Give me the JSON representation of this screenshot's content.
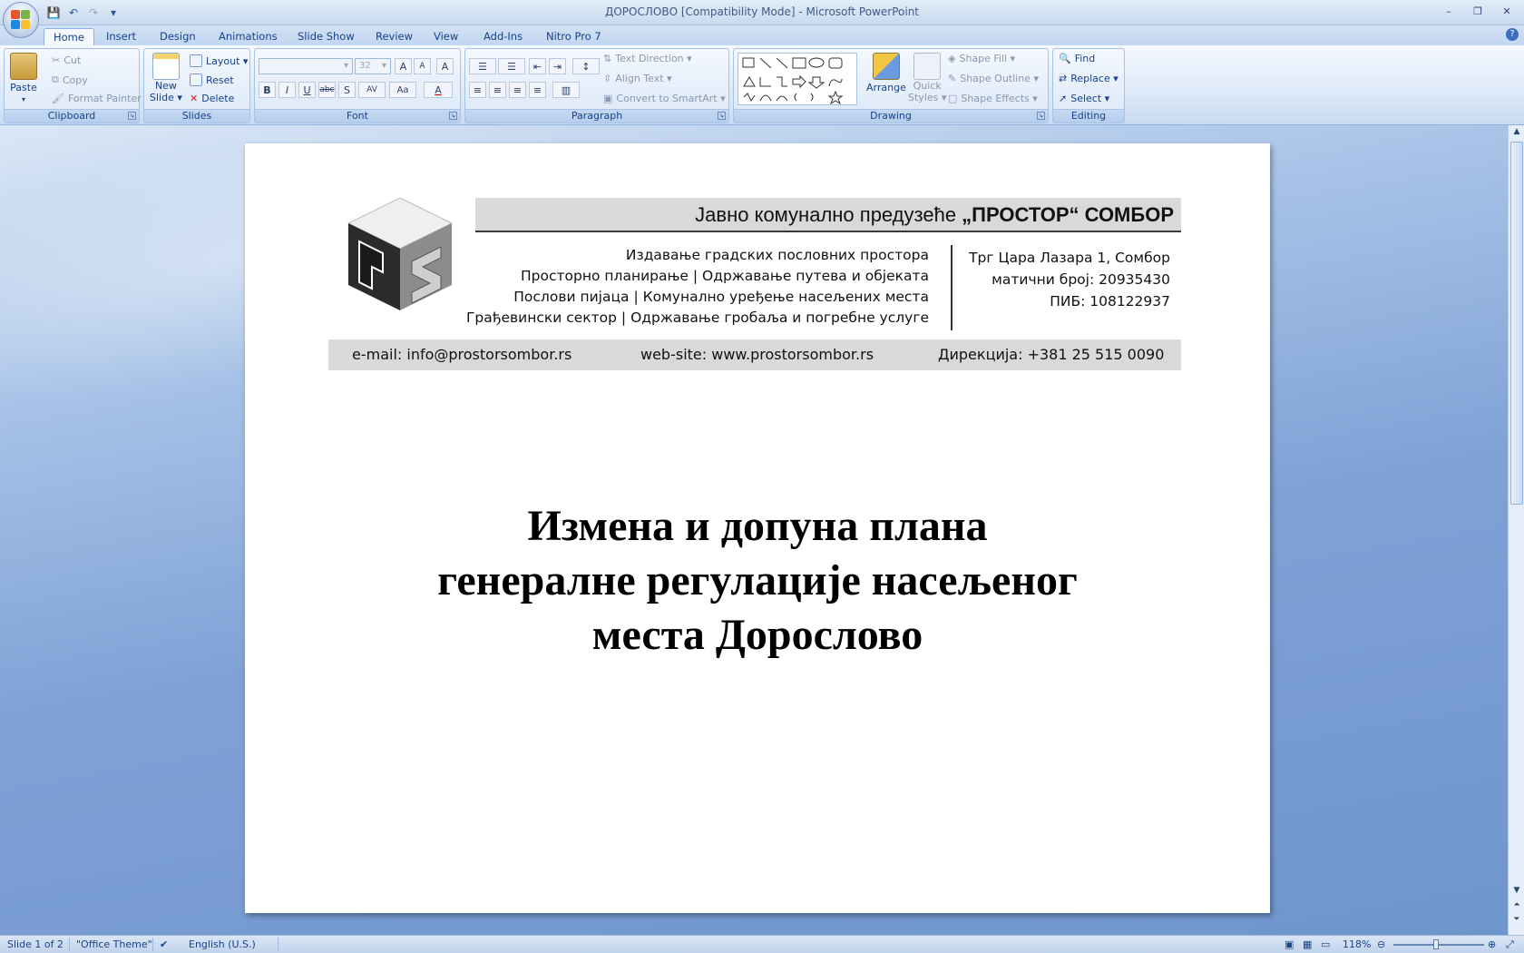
{
  "window": {
    "title": "ДОРОСЛОВО [Compatibility Mode] - Microsoft PowerPoint",
    "minimize": "–",
    "restore": "❐",
    "close": "✕"
  },
  "quick_access": {
    "save": "💾",
    "undo": "↶",
    "redo": "↷",
    "customize": "▾"
  },
  "tabs": [
    "Home",
    "Insert",
    "Design",
    "Animations",
    "Slide Show",
    "Review",
    "View",
    "Add-Ins",
    "Nitro Pro 7"
  ],
  "help": "?",
  "ribbon": {
    "clipboard": {
      "label": "Clipboard",
      "paste": "Paste",
      "cut": "Cut",
      "copy": "Copy",
      "format_painter": "Format Painter"
    },
    "slides": {
      "label": "Slides",
      "new_slide": "New",
      "new_slide_2": "Slide ▾",
      "layout": "Layout ▾",
      "reset": "Reset",
      "delete": "Delete"
    },
    "font": {
      "label": "Font",
      "font_name": "",
      "font_size": "32",
      "grow": "A",
      "shrink": "A",
      "clear": "A",
      "bold": "B",
      "italic": "I",
      "underline": "U",
      "strike": "abc",
      "shadow": "S",
      "spacing": "AV",
      "case": "Aa",
      "color": "A"
    },
    "paragraph": {
      "label": "Paragraph",
      "text_direction": "Text Direction ▾",
      "align_text": "Align Text ▾",
      "convert_smartart": "Convert to SmartArt ▾"
    },
    "drawing": {
      "label": "Drawing",
      "arrange": "Arrange",
      "quick": "Quick",
      "styles": "Styles ▾",
      "shape_fill": "Shape Fill ▾",
      "shape_outline": "Shape Outline ▾",
      "shape_effects": "Shape Effects ▾"
    },
    "editing": {
      "label": "Editing",
      "find": "Find",
      "replace": "Replace ▾",
      "select": "Select ▾"
    }
  },
  "slide": {
    "company_prefix": "Јавно комунално предузеће ",
    "company_name": "„ПРОСТОР“ СОМБОР",
    "services": [
      "Издавање градских пословних простора",
      "Просторно планирање | Одржавање путева и објеката",
      "Послови пијаца | Комунално уређење насељених места",
      "Грађевински сектор | Одржавање гробаља и погребне услуге"
    ],
    "address": [
      "Трг Цара Лазара 1, Сомбор",
      "матични број: 20935430",
      "ПИБ: 108122937"
    ],
    "email": "e-mail: info@prostorsombor.rs",
    "website": "web-site: www.prostorsombor.rs",
    "phone": "Дирекција: +381 25 515 0090",
    "title_lines": [
      "Измена и допуна плана",
      "генералне регулације насељеног",
      "места Дорослово"
    ]
  },
  "status": {
    "slide_of": "Slide 1 of 2",
    "theme": "\"Office Theme\"",
    "language": "English (U.S.)",
    "zoom": "118%"
  }
}
